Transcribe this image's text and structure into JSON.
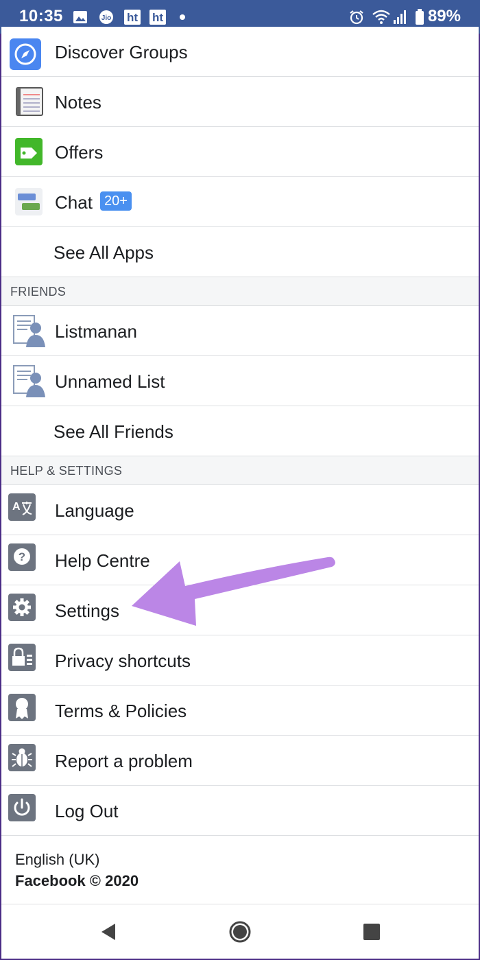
{
  "status_bar": {
    "time": "10:35",
    "battery_percent": "89%",
    "notification_icons": [
      "image-icon",
      "jio-icon",
      "ht-icon",
      "ht-icon",
      "dot-icon"
    ],
    "system_icons": [
      "alarm-icon",
      "wifi-icon",
      "signal-icon",
      "battery-icon"
    ],
    "notif_ht_1": "ht",
    "notif_ht_2": "ht",
    "notif_jio": "Jio"
  },
  "apps": {
    "items": [
      {
        "label": "Discover Groups",
        "icon": "compass-icon"
      },
      {
        "label": "Notes",
        "icon": "notebook-icon"
      },
      {
        "label": "Offers",
        "icon": "offer-tag-icon"
      },
      {
        "label": "Chat",
        "icon": "chat-bubbles-icon",
        "badge": "20+"
      },
      {
        "label": "See All Apps"
      }
    ]
  },
  "friends": {
    "section_title": "FRIENDS",
    "items": [
      {
        "label": "Listmanan",
        "icon": "friend-list-icon"
      },
      {
        "label": "Unnamed List",
        "icon": "friend-list-icon"
      },
      {
        "label": "See All Friends"
      }
    ]
  },
  "help_settings": {
    "section_title": "HELP & SETTINGS",
    "items": [
      {
        "label": "Language",
        "icon": "language-icon"
      },
      {
        "label": "Help Centre",
        "icon": "question-icon"
      },
      {
        "label": "Settings",
        "icon": "gear-icon"
      },
      {
        "label": "Privacy shortcuts",
        "icon": "lock-list-icon"
      },
      {
        "label": "Terms & Policies",
        "icon": "ribbon-badge-icon"
      },
      {
        "label": "Report a problem",
        "icon": "bug-icon"
      },
      {
        "label": "Log Out",
        "icon": "power-icon"
      }
    ]
  },
  "footer": {
    "language": "English (UK)",
    "copyright": "Facebook © 2020"
  },
  "colors": {
    "status_bar": "#3b5a9a",
    "badge": "#4a90f0",
    "annotation_arrow": "#bb86e6",
    "section_bg": "#f5f6f7",
    "divider": "#dddfe2"
  }
}
